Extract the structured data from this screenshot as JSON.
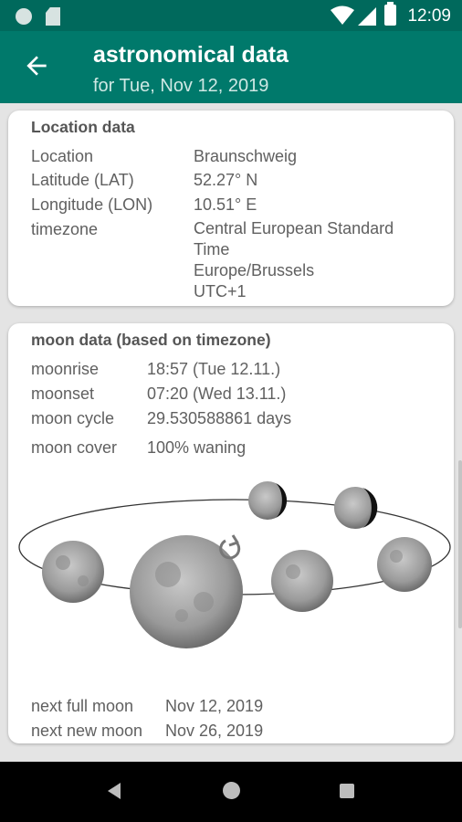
{
  "status": {
    "time": "12:09"
  },
  "header": {
    "title": "astronomical data",
    "subtitle": "for Tue, Nov 12, 2019"
  },
  "location": {
    "title": "Location data",
    "rows": [
      {
        "label": "Location",
        "value": "Braunschweig"
      },
      {
        "label": "Latitude (LAT)",
        "value": "52.27° N"
      },
      {
        "label": "Longitude (LON)",
        "value": "10.51° E"
      },
      {
        "label": "timezone",
        "value_lines": [
          "Central European Standard",
          "Time",
          "Europe/Brussels",
          "UTC+1"
        ]
      }
    ]
  },
  "moon": {
    "title": "moon data (based on timezone)",
    "rows": [
      {
        "label": "moonrise",
        "value": "18:57  (Tue 12.11.)"
      },
      {
        "label": "moonset",
        "value": "07:20  (Wed 13.11.)"
      },
      {
        "label": "moon cycle",
        "value": "29.530588861 days"
      },
      {
        "label": "moon cover",
        "value": "100%  waning"
      }
    ],
    "next": [
      {
        "label": "next full moon",
        "value": "Nov 12, 2019"
      },
      {
        "label": "next new moon",
        "value": "Nov 26, 2019"
      }
    ]
  },
  "icons": {
    "back": "arrow-back-icon",
    "rotate": "rotate-icon",
    "nav_back": "triangle-back-icon",
    "nav_home": "circle-home-icon",
    "nav_recent": "square-recent-icon"
  },
  "colors": {
    "appbar": "#00796b",
    "statusbar": "#00695c",
    "card_bg": "#ffffff",
    "text": "#606060"
  }
}
